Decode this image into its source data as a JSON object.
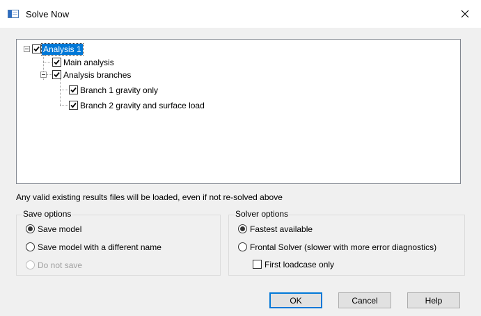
{
  "window": {
    "title": "Solve Now"
  },
  "tree": {
    "root": {
      "label": "Analysis 1",
      "checked": true,
      "selected": true
    },
    "main": {
      "label": "Main analysis",
      "checked": true
    },
    "branches": {
      "label": "Analysis branches",
      "checked": true
    },
    "branch1": {
      "label": "Branch 1 gravity only",
      "checked": true
    },
    "branch2": {
      "label": "Branch 2 gravity and surface load",
      "checked": true
    }
  },
  "note": "Any valid existing results files will be loaded, even if not re-solved above",
  "save_options": {
    "title": "Save options",
    "options": [
      {
        "label": "Save model",
        "checked": true,
        "enabled": true
      },
      {
        "label": "Save model with a different name",
        "checked": false,
        "enabled": true
      },
      {
        "label": "Do not save",
        "checked": false,
        "enabled": false
      }
    ]
  },
  "solver_options": {
    "title": "Solver options",
    "options": [
      {
        "label": "Fastest available",
        "checked": true
      },
      {
        "label": "Frontal Solver (slower with more error diagnostics)",
        "checked": false
      }
    ],
    "first_loadcase_label": "First loadcase only",
    "first_loadcase_checked": false
  },
  "buttons": {
    "ok": "OK",
    "cancel": "Cancel",
    "help": "Help"
  },
  "colors": {
    "selection": "#0078d7",
    "default_button_border": "#0078d7"
  }
}
